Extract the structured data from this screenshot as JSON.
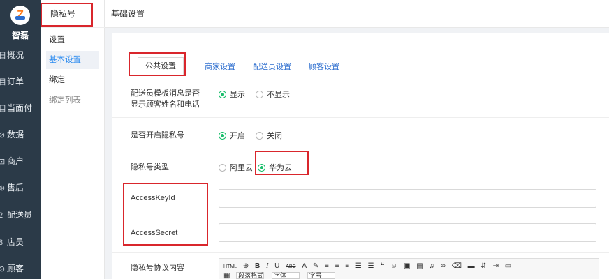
{
  "rail": {
    "brand": "智磊",
    "items": [
      {
        "icon": "日",
        "label": "概况"
      },
      {
        "icon": "目",
        "label": "订单"
      },
      {
        "icon": "目",
        "label": "当面付"
      },
      {
        "icon": "⊘",
        "label": "数据"
      },
      {
        "icon": "⊡",
        "label": "商户"
      },
      {
        "icon": "⊛",
        "label": "售后"
      },
      {
        "icon": "2",
        "label": "配送员"
      },
      {
        "icon": "8",
        "label": "店员"
      },
      {
        "icon": "⊙",
        "label": "顾客"
      }
    ]
  },
  "subnav": {
    "title": "隐私号",
    "section_settings": "设置",
    "item_basic": "基本设置",
    "section_bind": "绑定",
    "item_bind_list": "绑定列表"
  },
  "topbar": {
    "title": "基础设置"
  },
  "tabs": [
    "公共设置",
    "商家设置",
    "配送员设置",
    "顾客设置"
  ],
  "form": {
    "rider_template": {
      "label_line1": "配送员模板消息是否",
      "label_line2": "显示顾客姓名和电话",
      "options": [
        "显示",
        "不显示"
      ],
      "selected": 0
    },
    "enable_privacy": {
      "label": "是否开启隐私号",
      "options": [
        "开启",
        "关闭"
      ],
      "selected": 0
    },
    "privacy_type": {
      "label": "隐私号类型",
      "options": [
        "阿里云",
        "华为云"
      ],
      "selected": 1
    },
    "access_key_id": {
      "label": "AccessKeyId",
      "value": ""
    },
    "access_secret": {
      "label": "AccessSecret",
      "value": ""
    },
    "agreement": {
      "label": "隐私号协议内容"
    }
  },
  "editor": {
    "html_label": "HTML",
    "bold": "B",
    "italic": "I",
    "underline": "U",
    "strike": "ABC",
    "font_color": "A",
    "para_format": "段落格式",
    "font_family": "字体",
    "font_size": "字号"
  }
}
